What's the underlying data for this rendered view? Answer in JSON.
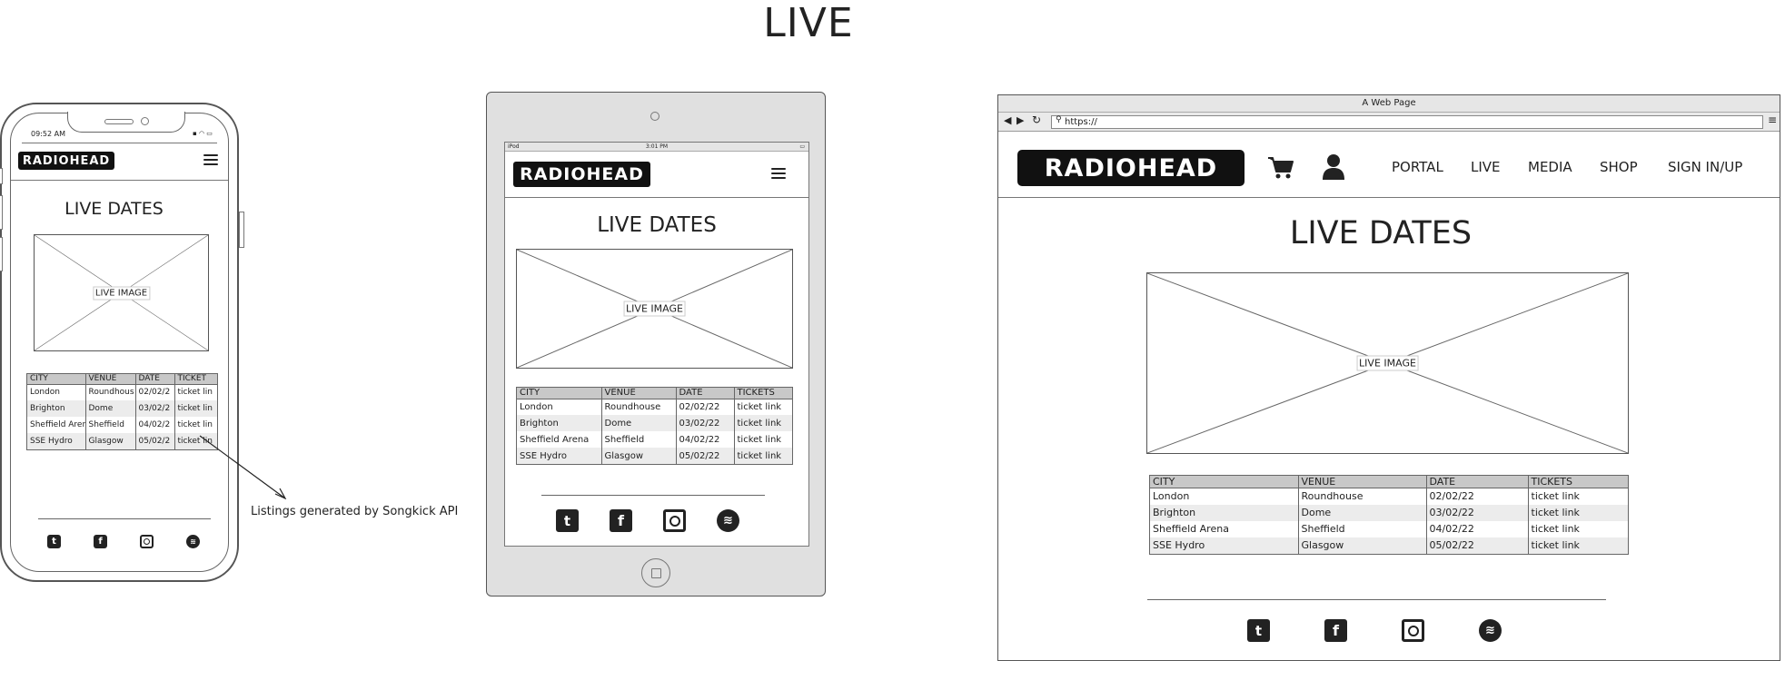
{
  "page_title": "LIVE",
  "header": {
    "logo": "RADIOHEAD"
  },
  "section_title": "LIVE DATES",
  "image_label": "LIVE IMAGE",
  "phone": {
    "time": "09:52 AM",
    "table": {
      "headers": [
        "CITY",
        "VENUE",
        "DATE",
        "TICKET"
      ],
      "rows": [
        [
          "London",
          "Roundhous",
          "02/02/2",
          "ticket lin"
        ],
        [
          "Brighton",
          "Dome",
          "03/02/2",
          "ticket lin"
        ],
        [
          "Sheffield Aren",
          "Sheffield",
          "04/02/2",
          "ticket lin"
        ],
        [
          "SSE Hydro",
          "Glasgow",
          "05/02/2",
          "ticket lin"
        ]
      ]
    }
  },
  "tablet": {
    "carrier": "iPod",
    "time": "3:01 PM"
  },
  "table": {
    "headers": [
      "CITY",
      "VENUE",
      "DATE",
      "TICKETS"
    ],
    "rows": [
      [
        "London",
        "Roundhouse",
        "02/02/22",
        "ticket link"
      ],
      [
        "Brighton",
        "Dome",
        "03/02/22",
        "ticket link"
      ],
      [
        "Sheffield Arena",
        "Sheffield",
        "04/02/22",
        "ticket link"
      ],
      [
        "SSE Hydro",
        "Glasgow",
        "05/02/22",
        "ticket link"
      ]
    ]
  },
  "browser": {
    "window_title": "A Web Page",
    "url": "https://",
    "nav": [
      "PORTAL",
      "LIVE",
      "MEDIA",
      "SHOP",
      "SIGN IN/UP"
    ]
  },
  "annotation": "Listings generated by Songkick API",
  "social_icons": [
    "twitter-icon",
    "facebook-icon",
    "instagram-icon",
    "spotify-icon"
  ]
}
